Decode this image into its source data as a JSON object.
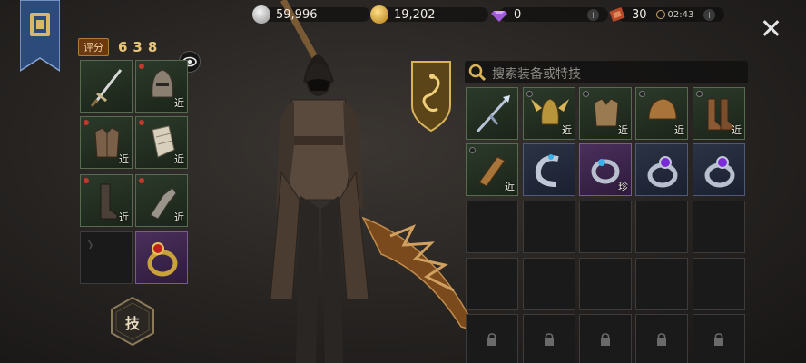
{
  "currencies": [
    {
      "name": "silver",
      "value": "59,996",
      "color": "#cfcfcf"
    },
    {
      "name": "gold",
      "value": "19,202",
      "color": "#d8a21d"
    },
    {
      "name": "diamond",
      "value": "0",
      "color": "#a15bd8"
    },
    {
      "name": "ticket",
      "value": "30",
      "color": "#b84a2a"
    }
  ],
  "timer": "02:43",
  "score": {
    "label": "评分",
    "value": "638"
  },
  "search": {
    "placeholder": "搜索装备或特技"
  },
  "skill_button": {
    "label": "技"
  },
  "tag_near": "近",
  "tag_rare": "珍"
}
